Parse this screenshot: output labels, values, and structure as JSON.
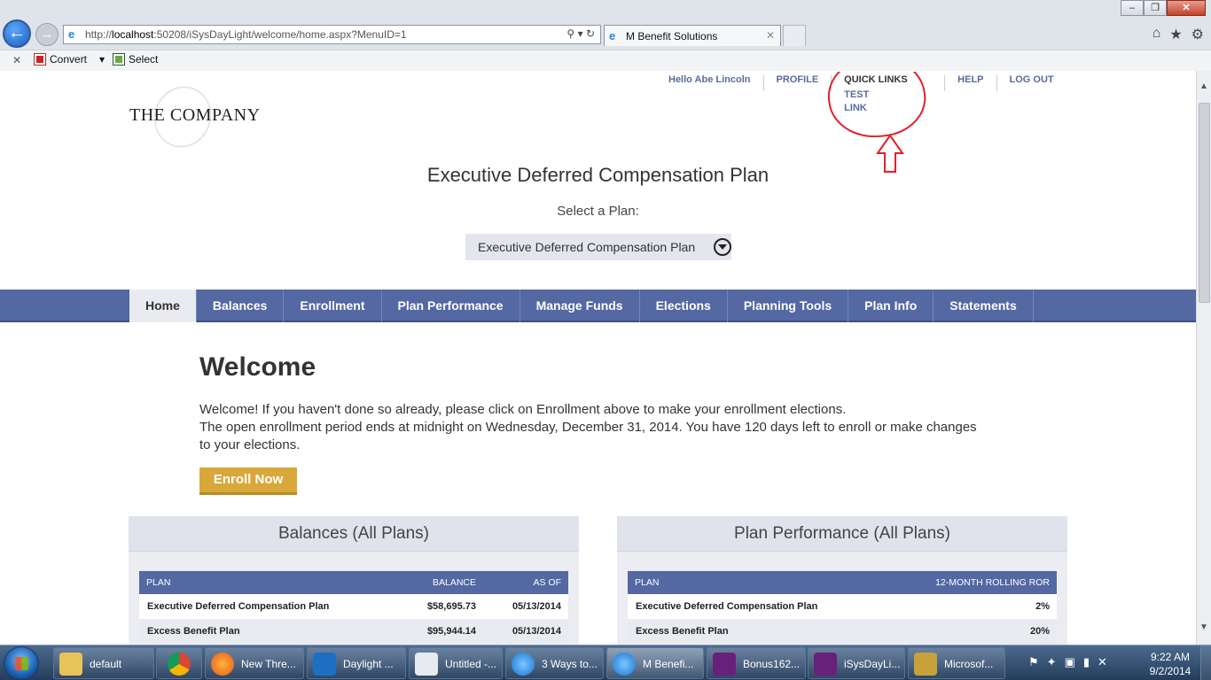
{
  "browser": {
    "address": {
      "url_prefix": "http://",
      "url_host": "localhost",
      "url_rest": ":50208/iSysDayLight/welcome/home.aspx?MenuID=1"
    },
    "tab_title": "M Benefit Solutions",
    "command_bar": {
      "convert_label": "Convert",
      "select_label": "Select"
    }
  },
  "header": {
    "logo_text": "THE COMPANY",
    "top_nav": {
      "greeting": "Hello Abe Lincoln",
      "profile": "PROFILE",
      "quick_links": "QUICK LINKS",
      "quick_links_items": [
        "TEST",
        "LINK"
      ],
      "help": "HELP",
      "logout": "LOG OUT"
    }
  },
  "plan": {
    "title": "Executive Deferred Compensation Plan",
    "select_label": "Select a Plan:",
    "selected": "Executive Deferred Compensation Plan"
  },
  "main_nav": [
    "Home",
    "Balances",
    "Enrollment",
    "Plan Performance",
    "Manage Funds",
    "Elections",
    "Planning Tools",
    "Plan Info",
    "Statements"
  ],
  "welcome": {
    "heading": "Welcome",
    "line1": "Welcome! If you haven't done so already, please click on Enrollment above to make your enrollment elections.",
    "line2": "The open enrollment period ends at midnight on Wednesday, December 31, 2014. You have 120 days left to enroll or make changes to your elections.",
    "enroll_button": "Enroll Now"
  },
  "balances_panel": {
    "title": "Balances (All Plans)",
    "columns": [
      "PLAN",
      "BALANCE",
      "AS OF"
    ],
    "rows": [
      [
        "Executive Deferred Compensation Plan",
        "$58,695.73",
        "05/13/2014"
      ],
      [
        "Excess Benefit Plan",
        "$95,944.14",
        "05/13/2014"
      ]
    ]
  },
  "performance_panel": {
    "title": "Plan Performance (All Plans)",
    "columns": [
      "PLAN",
      "12-MONTH ROLLING ROR"
    ],
    "rows": [
      [
        "Executive Deferred Compensation Plan",
        "2%"
      ],
      [
        "Excess Benefit Plan",
        "20%"
      ]
    ]
  },
  "taskbar": {
    "items": [
      "default",
      "",
      "New Thre...",
      "Daylight ...",
      "Untitled -...",
      "3 Ways to...",
      "M Benefi...",
      "Bonus162...",
      "iSysDayLi...",
      "Microsof..."
    ],
    "time": "9:22 AM",
    "date": "9/2/2014"
  },
  "colors": {
    "nav_blue": "#5468a3",
    "accent_gold": "#d9a83a",
    "annotation_red": "#e21f2a"
  }
}
